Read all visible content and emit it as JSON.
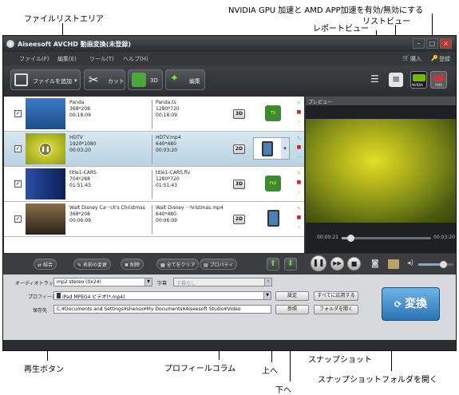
{
  "callouts": {
    "file_list_area": "ファイルリストエリア",
    "gpu": "NVIDIA GPU 加速と AMD APP加速を有効/無効にする",
    "list_view": "リストビュー",
    "report_view": "レポートビュー",
    "play_button": "再生ボタン",
    "profile_column": "プロフィールコラム",
    "move_up": "上へ",
    "move_down": "下へ",
    "snapshot": "スナップショット",
    "open_snapshot_folder": "スナップショットフォルダを開く"
  },
  "window": {
    "title": "Aiseesoft AVCHD 動画変換(未登録)",
    "minimize": "–",
    "maximize": "□",
    "close": "×"
  },
  "menu": [
    "ファイル(F)",
    "編集(E)",
    "ツール(T)",
    "ヘルプ(H)"
  ],
  "menu_right": {
    "purchase": "購入",
    "register": "登録"
  },
  "toolbar": {
    "add_file": "ファイルを追加",
    "cut": "カット",
    "three_d": "3D",
    "edit": "編集",
    "nvidia": "NVIDIA",
    "amd": "AMD"
  },
  "files": [
    {
      "name": "Panda",
      "res": "368*208",
      "dur": "00:18:09",
      "out_name": "Panda.ts",
      "out_res": "1280*720",
      "out_dur": "00:18:09",
      "mode": "3D",
      "profile_badge": "TS"
    },
    {
      "name": "HDTV",
      "res": "1920*1080",
      "dur": "00:03:20",
      "out_name": "HDTV.mp4",
      "out_res": "640*480",
      "out_dur": "00:03:20",
      "mode": "2D",
      "profile_badge": ""
    },
    {
      "name": "title1-CARS",
      "res": "704*288",
      "dur": "01:51:43",
      "out_name": "title1-CARS.flv",
      "out_res": "1280*720",
      "out_dur": "01:51:43",
      "mode": "3D",
      "profile_badge": "FLV"
    },
    {
      "name": "Walt Disney Ca···ck's Christmas",
      "res": "368*208",
      "dur": "00:06:09",
      "out_name": "Walt Disney ···hristmas.mp4",
      "out_res": "640*480",
      "out_dur": "00:06:09",
      "mode": "2D",
      "profile_badge": ""
    }
  ],
  "preview": {
    "header": "プレビュー",
    "time_current": "00:00:21",
    "time_total": "00:03:20",
    "seek_progress": 0.1,
    "volume_level": 0.7
  },
  "actions": {
    "merge": "結合",
    "rename": "名前の変更",
    "delete": "削除",
    "clear_all": "全てをクリア",
    "properties": "プロパティ"
  },
  "settings": {
    "audio_track_label": "オーディオトラック",
    "audio_track_value": "mp2 stereo (0x24)",
    "subtitle_label": "字幕",
    "subtitle_value": "字幕なし",
    "profile_label": "プロフィール",
    "profile_value": "iPad MPEG4 ビデオ(*.mp4)",
    "settings_btn": "設定",
    "apply_all_btn": "すべてに応用する",
    "dest_label": "保存先",
    "dest_value": "C:¥Documents and Settings¥shensx¥My Documents¥Aiseesoft Studio¥Video",
    "browse_btn": "参照",
    "open_folder_btn": "フォルダを開く",
    "convert": "変換"
  },
  "colors": {
    "accent": "#2a73b4",
    "selected_row": "#c8dcea",
    "app_bg": "#2e3033",
    "up_down": "#6dd33a"
  }
}
